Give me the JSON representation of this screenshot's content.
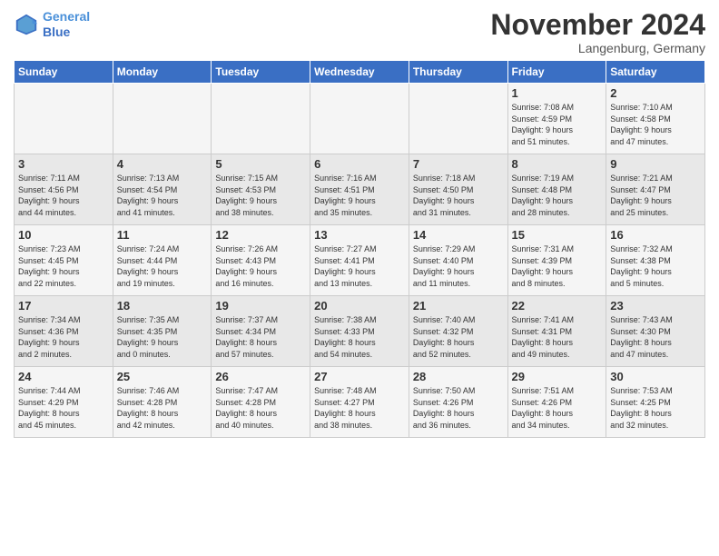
{
  "logo": {
    "line1": "General",
    "line2": "Blue"
  },
  "title": "November 2024",
  "location": "Langenburg, Germany",
  "days_header": [
    "Sunday",
    "Monday",
    "Tuesday",
    "Wednesday",
    "Thursday",
    "Friday",
    "Saturday"
  ],
  "weeks": [
    [
      {
        "day": "",
        "info": ""
      },
      {
        "day": "",
        "info": ""
      },
      {
        "day": "",
        "info": ""
      },
      {
        "day": "",
        "info": ""
      },
      {
        "day": "",
        "info": ""
      },
      {
        "day": "1",
        "info": "Sunrise: 7:08 AM\nSunset: 4:59 PM\nDaylight: 9 hours\nand 51 minutes."
      },
      {
        "day": "2",
        "info": "Sunrise: 7:10 AM\nSunset: 4:58 PM\nDaylight: 9 hours\nand 47 minutes."
      }
    ],
    [
      {
        "day": "3",
        "info": "Sunrise: 7:11 AM\nSunset: 4:56 PM\nDaylight: 9 hours\nand 44 minutes."
      },
      {
        "day": "4",
        "info": "Sunrise: 7:13 AM\nSunset: 4:54 PM\nDaylight: 9 hours\nand 41 minutes."
      },
      {
        "day": "5",
        "info": "Sunrise: 7:15 AM\nSunset: 4:53 PM\nDaylight: 9 hours\nand 38 minutes."
      },
      {
        "day": "6",
        "info": "Sunrise: 7:16 AM\nSunset: 4:51 PM\nDaylight: 9 hours\nand 35 minutes."
      },
      {
        "day": "7",
        "info": "Sunrise: 7:18 AM\nSunset: 4:50 PM\nDaylight: 9 hours\nand 31 minutes."
      },
      {
        "day": "8",
        "info": "Sunrise: 7:19 AM\nSunset: 4:48 PM\nDaylight: 9 hours\nand 28 minutes."
      },
      {
        "day": "9",
        "info": "Sunrise: 7:21 AM\nSunset: 4:47 PM\nDaylight: 9 hours\nand 25 minutes."
      }
    ],
    [
      {
        "day": "10",
        "info": "Sunrise: 7:23 AM\nSunset: 4:45 PM\nDaylight: 9 hours\nand 22 minutes."
      },
      {
        "day": "11",
        "info": "Sunrise: 7:24 AM\nSunset: 4:44 PM\nDaylight: 9 hours\nand 19 minutes."
      },
      {
        "day": "12",
        "info": "Sunrise: 7:26 AM\nSunset: 4:43 PM\nDaylight: 9 hours\nand 16 minutes."
      },
      {
        "day": "13",
        "info": "Sunrise: 7:27 AM\nSunset: 4:41 PM\nDaylight: 9 hours\nand 13 minutes."
      },
      {
        "day": "14",
        "info": "Sunrise: 7:29 AM\nSunset: 4:40 PM\nDaylight: 9 hours\nand 11 minutes."
      },
      {
        "day": "15",
        "info": "Sunrise: 7:31 AM\nSunset: 4:39 PM\nDaylight: 9 hours\nand 8 minutes."
      },
      {
        "day": "16",
        "info": "Sunrise: 7:32 AM\nSunset: 4:38 PM\nDaylight: 9 hours\nand 5 minutes."
      }
    ],
    [
      {
        "day": "17",
        "info": "Sunrise: 7:34 AM\nSunset: 4:36 PM\nDaylight: 9 hours\nand 2 minutes."
      },
      {
        "day": "18",
        "info": "Sunrise: 7:35 AM\nSunset: 4:35 PM\nDaylight: 9 hours\nand 0 minutes."
      },
      {
        "day": "19",
        "info": "Sunrise: 7:37 AM\nSunset: 4:34 PM\nDaylight: 8 hours\nand 57 minutes."
      },
      {
        "day": "20",
        "info": "Sunrise: 7:38 AM\nSunset: 4:33 PM\nDaylight: 8 hours\nand 54 minutes."
      },
      {
        "day": "21",
        "info": "Sunrise: 7:40 AM\nSunset: 4:32 PM\nDaylight: 8 hours\nand 52 minutes."
      },
      {
        "day": "22",
        "info": "Sunrise: 7:41 AM\nSunset: 4:31 PM\nDaylight: 8 hours\nand 49 minutes."
      },
      {
        "day": "23",
        "info": "Sunrise: 7:43 AM\nSunset: 4:30 PM\nDaylight: 8 hours\nand 47 minutes."
      }
    ],
    [
      {
        "day": "24",
        "info": "Sunrise: 7:44 AM\nSunset: 4:29 PM\nDaylight: 8 hours\nand 45 minutes."
      },
      {
        "day": "25",
        "info": "Sunrise: 7:46 AM\nSunset: 4:28 PM\nDaylight: 8 hours\nand 42 minutes."
      },
      {
        "day": "26",
        "info": "Sunrise: 7:47 AM\nSunset: 4:28 PM\nDaylight: 8 hours\nand 40 minutes."
      },
      {
        "day": "27",
        "info": "Sunrise: 7:48 AM\nSunset: 4:27 PM\nDaylight: 8 hours\nand 38 minutes."
      },
      {
        "day": "28",
        "info": "Sunrise: 7:50 AM\nSunset: 4:26 PM\nDaylight: 8 hours\nand 36 minutes."
      },
      {
        "day": "29",
        "info": "Sunrise: 7:51 AM\nSunset: 4:26 PM\nDaylight: 8 hours\nand 34 minutes."
      },
      {
        "day": "30",
        "info": "Sunrise: 7:53 AM\nSunset: 4:25 PM\nDaylight: 8 hours\nand 32 minutes."
      }
    ]
  ]
}
